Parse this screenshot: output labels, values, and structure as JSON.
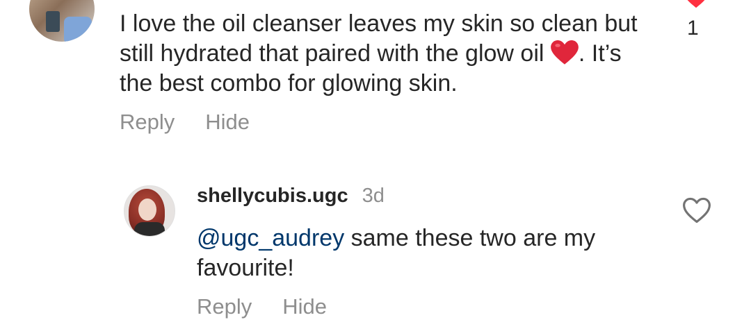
{
  "comment_1": {
    "text_line_before_emoji": "I love the oil cleanser leaves my skin so clean but still hydrated that paired with the glow oil",
    "emoji": "red-heart",
    "text_after_emoji": ". It’s the best combo for glowing skin.",
    "actions": {
      "reply": "Reply",
      "hide": "Hide"
    },
    "like_count": "1",
    "liked": true
  },
  "comment_2": {
    "username": "shellycubis.ugc",
    "timestamp": "3d",
    "mention": "@ugc_audrey",
    "text": " same these two are my favourite!",
    "actions": {
      "reply": "Reply",
      "hide": "Hide"
    },
    "liked": false
  },
  "colors": {
    "text": "#262626",
    "secondary": "#8e8e8e",
    "mention": "#00376b",
    "like_red": "#ff3040"
  }
}
